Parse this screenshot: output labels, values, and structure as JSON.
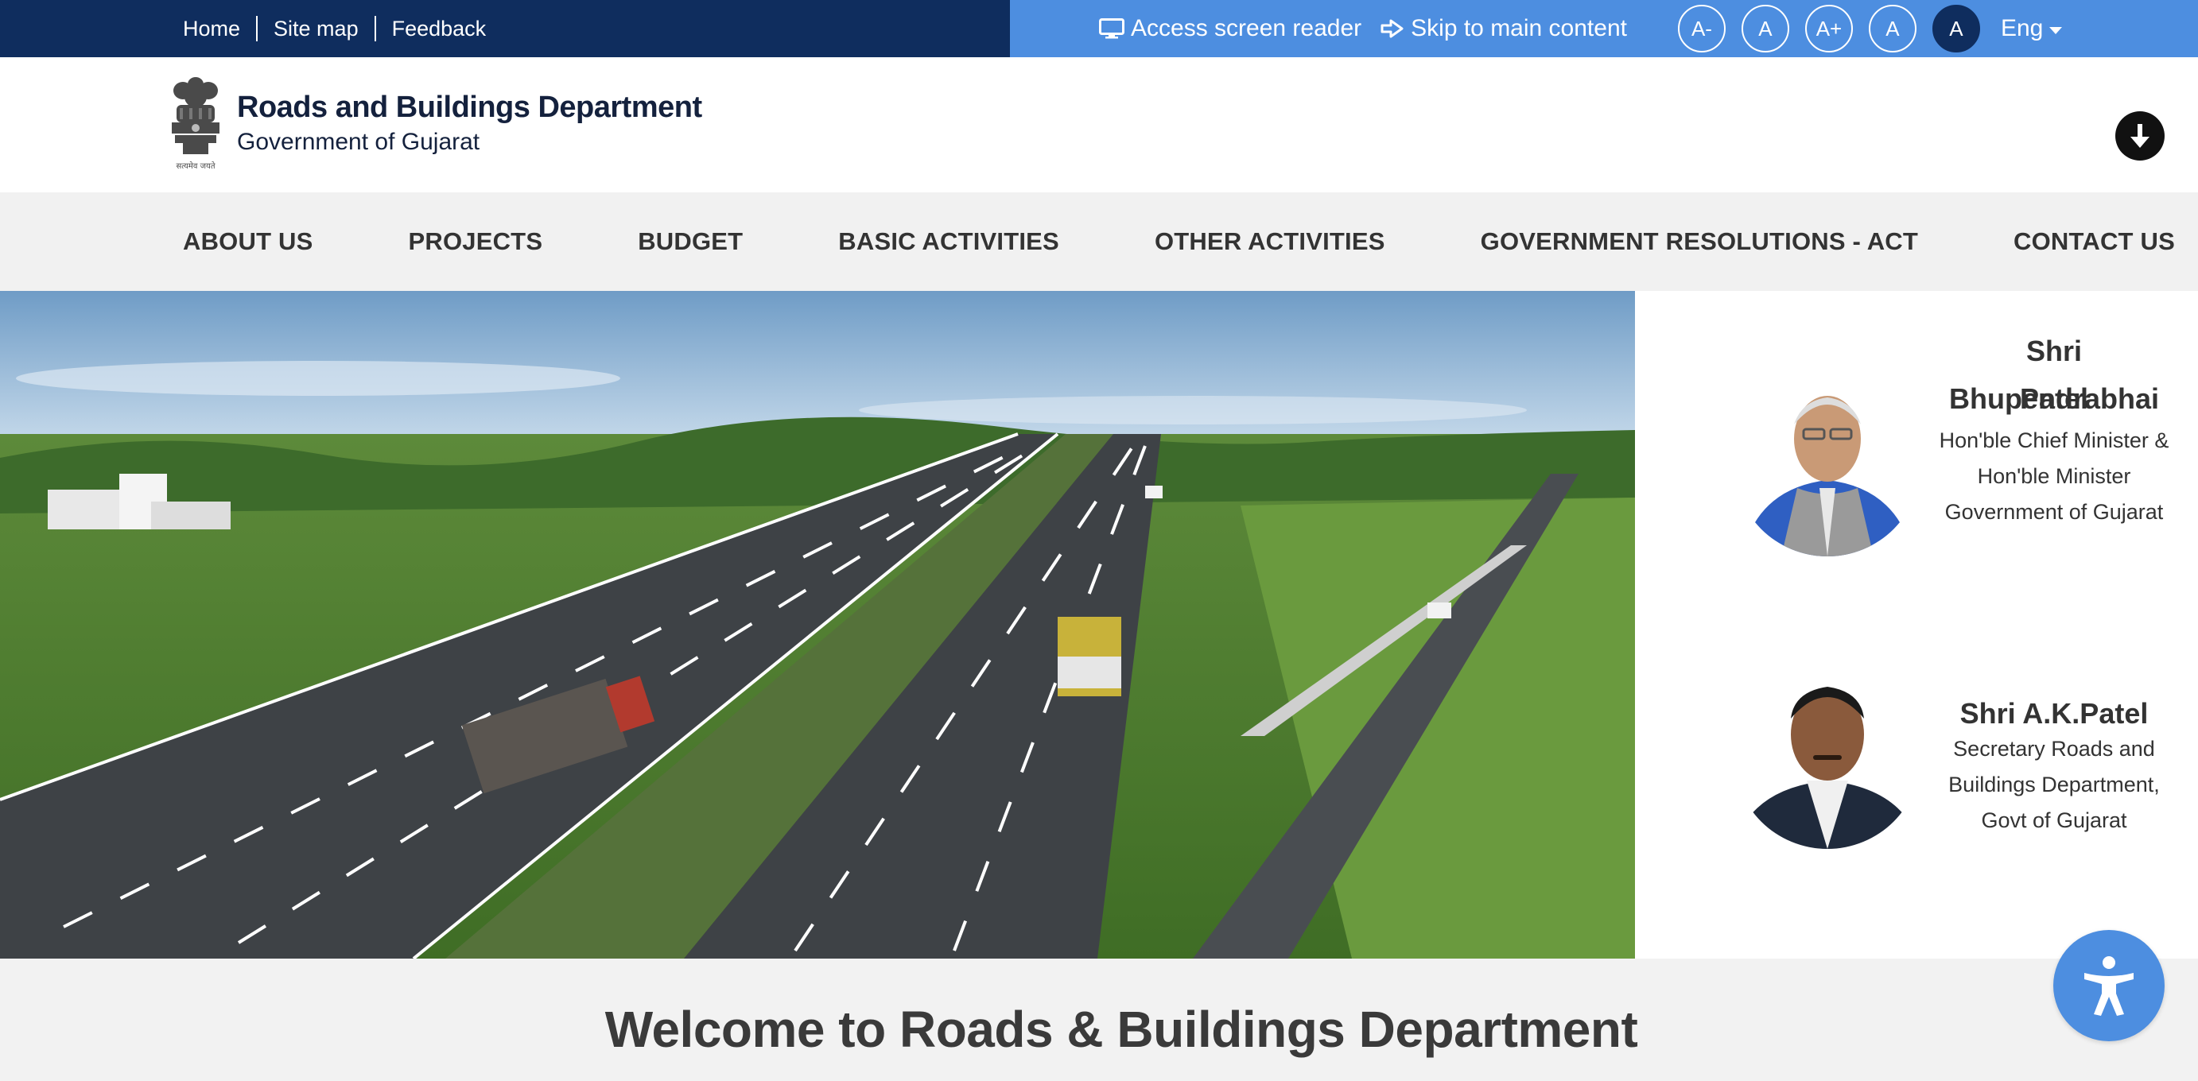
{
  "topbar": {
    "links": [
      "Home",
      "Site map",
      "Feedback"
    ],
    "screen_reader": "Access screen reader",
    "skip_main": "Skip to main content",
    "font_buttons": [
      "A-",
      "A",
      "A+",
      "A",
      "A"
    ],
    "language": "Eng"
  },
  "header": {
    "title": "Roads and Buildings Department",
    "subtitle": "Government of Gujarat",
    "emblem_caption": "सत्यमेव जयते"
  },
  "nav": {
    "items": [
      "ABOUT US",
      "PROJECTS",
      "BUDGET",
      "BASIC ACTIVITIES",
      "OTHER ACTIVITIES",
      "GOVERNMENT RESOLUTIONS - ACT",
      "CONTACT US"
    ]
  },
  "leaders": [
    {
      "name_line1": "Shri Bhupendrabhai",
      "name_line2": "Patel",
      "role_lines": [
        "Hon'ble Chief Minister &",
        "Hon'ble Minister",
        "Government of Gujarat"
      ]
    },
    {
      "name_line1": "Shri A.K.Patel",
      "role_lines": [
        "Secretary Roads and",
        "Buildings Department,",
        "Govt of Gujarat"
      ]
    }
  ],
  "welcome": "Welcome to Roads & Buildings Department",
  "icons": [
    "monitor-icon",
    "skip-arrow-icon",
    "arrow-down-icon",
    "accessibility-icon"
  ],
  "colors": {
    "topbar_dark": "#0f2d5e",
    "topbar_light": "#4d8ee0",
    "nav_bg": "#f1f1f1"
  }
}
